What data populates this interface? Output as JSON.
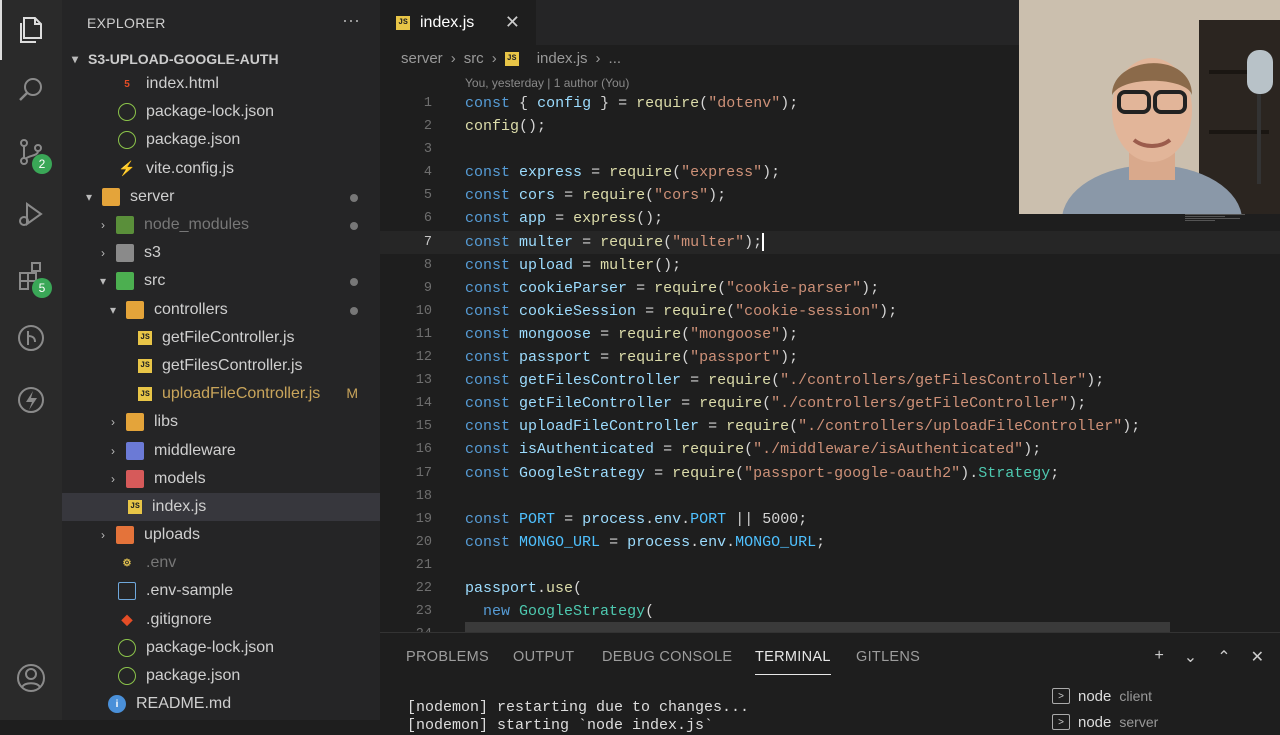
{
  "activity_bar": {
    "items": [
      {
        "name": "explorer",
        "badge": ""
      },
      {
        "name": "search",
        "badge": ""
      },
      {
        "name": "source-control",
        "badge": "2"
      },
      {
        "name": "run-debug",
        "badge": ""
      },
      {
        "name": "extensions",
        "badge": "5"
      },
      {
        "name": "gitlens",
        "badge": ""
      },
      {
        "name": "thunder",
        "badge": ""
      }
    ],
    "accounts": "account"
  },
  "sidebar": {
    "title": "EXPLORER",
    "more": "···",
    "root": "S3-UPLOAD-GOOGLE-AUTH",
    "items": [
      {
        "label": "index.html",
        "icon": "html"
      },
      {
        "label": "package-lock.json",
        "icon": "npm"
      },
      {
        "label": "package.json",
        "icon": "npm"
      },
      {
        "label": "vite.config.js",
        "icon": "vite"
      },
      {
        "label": "server",
        "icon": "folder"
      },
      {
        "label": "node_modules",
        "icon": "folder"
      },
      {
        "label": "s3",
        "icon": "folder"
      },
      {
        "label": "src",
        "icon": "folder"
      },
      {
        "label": "controllers",
        "icon": "folder"
      },
      {
        "label": "getFileController.js",
        "icon": "js"
      },
      {
        "label": "getFilesController.js",
        "icon": "js"
      },
      {
        "label": "uploadFileController.js",
        "icon": "js",
        "status": "M"
      },
      {
        "label": "libs",
        "icon": "folder"
      },
      {
        "label": "middleware",
        "icon": "folder"
      },
      {
        "label": "models",
        "icon": "folder"
      },
      {
        "label": "index.js",
        "icon": "js"
      },
      {
        "label": "uploads",
        "icon": "folder"
      },
      {
        "label": ".env",
        "icon": "env"
      },
      {
        "label": ".env-sample",
        "icon": "file"
      },
      {
        "label": ".gitignore",
        "icon": "git"
      },
      {
        "label": "package-lock.json",
        "icon": "npm"
      },
      {
        "label": "package.json",
        "icon": "npm"
      },
      {
        "label": "README.md",
        "icon": "info"
      }
    ]
  },
  "editor": {
    "tab": {
      "label": "index.js",
      "icon": "JS"
    },
    "breadcrumb": [
      "server",
      "src",
      "index.js",
      "..."
    ],
    "blame": "You, yesterday | 1 author (You)",
    "lines": [
      "const { config } = require(\"dotenv\");",
      "config();",
      "",
      "const express = require(\"express\");",
      "const cors = require(\"cors\");",
      "const app = express();",
      "const multer = require(\"multer\");",
      "const upload = multer();",
      "const cookieParser = require(\"cookie-parser\");",
      "const cookieSession = require(\"cookie-session\");",
      "const mongoose = require(\"mongoose\");",
      "const passport = require(\"passport\");",
      "const getFilesController = require(\"./controllers/getFilesController\");",
      "const getFileController = require(\"./controllers/getFileController\");",
      "const uploadFileController = require(\"./controllers/uploadFileController\");",
      "const isAuthenticated = require(\"./middleware/isAuthenticated\");",
      "const GoogleStrategy = require(\"passport-google-oauth2\").Strategy;",
      "",
      "const PORT = process.env.PORT || 5000;",
      "const MONGO_URL = process.env.MONGO_URL;",
      "",
      "passport.use(",
      "  new GoogleStrategy(",
      "    {"
    ],
    "current_line": 7
  },
  "panel": {
    "tabs": [
      "PROBLEMS",
      "OUTPUT",
      "DEBUG CONSOLE",
      "TERMINAL",
      "GITLENS"
    ],
    "active": "TERMINAL",
    "terminal_lines": [
      "[nodemon] restarting due to changes...",
      "[nodemon] starting `node index.js`"
    ],
    "terminals": [
      {
        "label": "node",
        "desc": "client"
      },
      {
        "label": "node",
        "desc": "server"
      }
    ]
  }
}
